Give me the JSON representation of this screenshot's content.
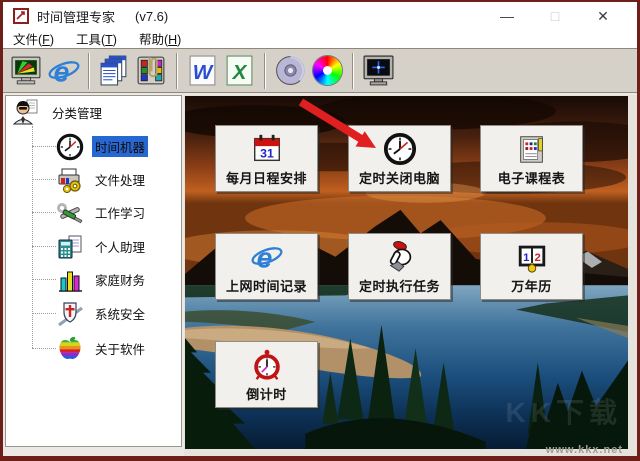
{
  "window": {
    "title": "时间管理专家",
    "version": "(v7.6)",
    "controls": {
      "minimize": "—",
      "maximize": "□",
      "close": "✕"
    }
  },
  "menu": {
    "items": [
      {
        "label": "文件(F)"
      },
      {
        "label": "工具(T)"
      },
      {
        "label": "帮助(H)"
      }
    ]
  },
  "toolbar": {
    "icons": [
      "screensaver-monitor-icon",
      "ie-browser-icon",
      "documents-stack-icon",
      "organizer-clipboard-icon",
      "word-icon",
      "excel-icon",
      "cd-disc-icon",
      "color-wheel-icon",
      "shutdown-monitor-icon"
    ],
    "word_letter": "W",
    "excel_letter": "X"
  },
  "sidebar": {
    "root_label": "分类管理",
    "items": [
      {
        "label": "时间机器",
        "icon": "clock-icon",
        "selected": true
      },
      {
        "label": "文件处理",
        "icon": "printer-gears-icon",
        "selected": false
      },
      {
        "label": "工作学习",
        "icon": "tools-icon",
        "selected": false
      },
      {
        "label": "个人助理",
        "icon": "calculator-icon",
        "selected": false
      },
      {
        "label": "家庭财务",
        "icon": "bar-chart-icon",
        "selected": false
      },
      {
        "label": "系统安全",
        "icon": "shield-sword-icon",
        "selected": false
      },
      {
        "label": "关于软件",
        "icon": "rainbow-apple-icon",
        "selected": false
      }
    ]
  },
  "main": {
    "buttons": [
      {
        "label": "每月日程安排",
        "icon": "calendar-31-icon"
      },
      {
        "label": "定时关闭电脑",
        "icon": "wall-clock-icon"
      },
      {
        "label": "电子课程表",
        "icon": "schedule-card-icon"
      },
      {
        "label": "上网时间记录",
        "icon": "ie-browser-icon"
      },
      {
        "label": "定时执行任务",
        "icon": "hand-press-icon"
      },
      {
        "label": "万年历",
        "icon": "perpetual-calendar-icon"
      },
      {
        "label": "倒计时",
        "icon": "alarm-clock-icon"
      }
    ],
    "icons_text": {
      "calendar_day": "31",
      "book_left_digit": "1",
      "book_right_digit": "2"
    },
    "watermark_site": "www.kkx.net",
    "watermark_overlay": "KK下载"
  },
  "colors": {
    "window_border": "#6e1f1a",
    "toolbar_bg": "#d5d1c9",
    "selection_blue": "#2767d2",
    "arrow_red": "#e02020",
    "tile_bg": "#f2f0ed"
  }
}
